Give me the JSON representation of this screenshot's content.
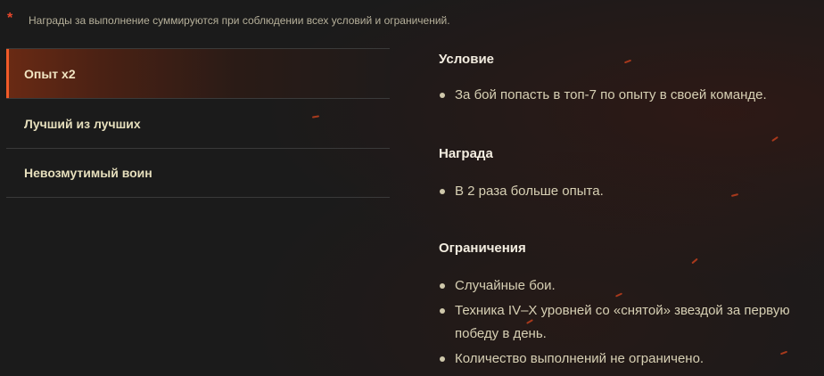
{
  "note": {
    "asterisk": "*",
    "text": "Награды за выполнение суммируются при соблюдении всех условий и ограничений."
  },
  "tabs": [
    {
      "label": "Опыт x2",
      "active": true
    },
    {
      "label": "Лучший из лучших",
      "active": false
    },
    {
      "label": "Невозмутимый воин",
      "active": false
    }
  ],
  "condition": {
    "title": "Условие",
    "items": [
      "За бой попасть в топ-7 по опыту в своей команде."
    ]
  },
  "reward": {
    "title": "Награда",
    "items": [
      "В 2 раза больше опыта."
    ]
  },
  "limits": {
    "title": "Ограничения",
    "items": [
      "Случайные бои.",
      "Техника IV–X уровней со «снятой» звездой за первую победу в день.",
      "Количество выполнений не ограничено."
    ]
  },
  "colors": {
    "accent": "#f05a28",
    "asterisk": "#e8472b",
    "background": "#1b1b1b"
  }
}
